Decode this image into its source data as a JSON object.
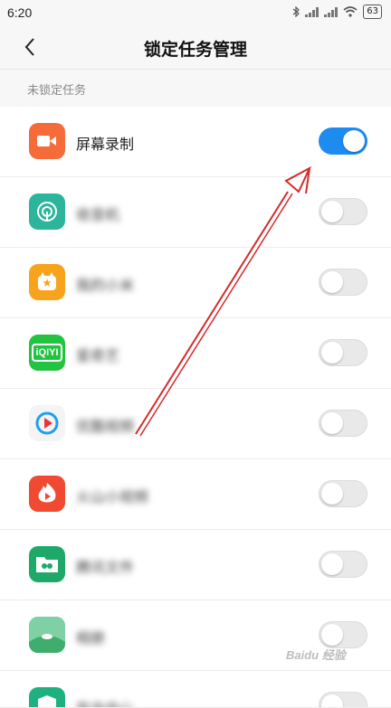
{
  "status_bar": {
    "time": "6:20",
    "battery": "63"
  },
  "header": {
    "title": "锁定任务管理"
  },
  "section": {
    "label": "未锁定任务"
  },
  "apps": [
    {
      "name": "屏幕录制",
      "icon": "video-icon",
      "color": "#f56b3a",
      "locked": true,
      "blurred": false
    },
    {
      "name": "收音机",
      "icon": "radio-icon",
      "color": "#2cb59a",
      "locked": false,
      "blurred": true
    },
    {
      "name": "我的小米",
      "icon": "mi-icon",
      "color": "#f7a31c",
      "locked": false,
      "blurred": true
    },
    {
      "name": "爱奇艺",
      "icon": "iqiyi-icon",
      "color": "#22c341",
      "locked": false,
      "blurred": true
    },
    {
      "name": "优酷视频",
      "icon": "youku-icon",
      "color": "#f4f4f4",
      "locked": false,
      "blurred": true
    },
    {
      "name": "火山小视频",
      "icon": "flame-icon",
      "color": "#f04a32",
      "locked": false,
      "blurred": true
    },
    {
      "name": "腾讯文件",
      "icon": "folder-icon",
      "color": "#1ea968",
      "locked": false,
      "blurred": true
    },
    {
      "name": "相册",
      "icon": "gallery-icon",
      "color": "#5cc08a",
      "locked": false,
      "blurred": true
    },
    {
      "name": "安全中心",
      "icon": "security-icon",
      "color": "#1eb07e",
      "locked": false,
      "blurred": true
    }
  ],
  "watermark": "Baidu 经验",
  "colors": {
    "toggle_on": "#1d8bf0",
    "arrow": "#d42a2a"
  }
}
